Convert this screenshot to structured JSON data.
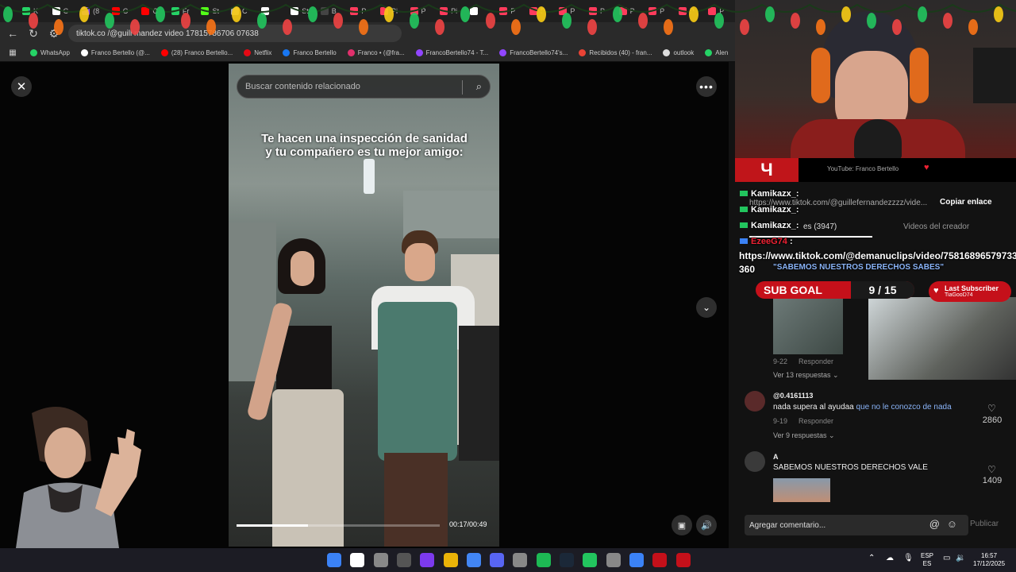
{
  "browser": {
    "url": "tiktok.com/@guillefernandezzzz/video/7581781578670607638",
    "url_display": "tiktok.co    /@guill    mandez     video    17815786706 07638",
    "tabs": [
      {
        "label": "K",
        "color": "#25d366"
      },
      {
        "label": "C",
        "color": "#ffffff"
      },
      {
        "label": "(8",
        "color": "#9146ff"
      },
      {
        "label": "C",
        "color": "#ff0000"
      },
      {
        "label": "C",
        "color": "#ff0000"
      },
      {
        "label": "Fr",
        "color": "#25d366"
      },
      {
        "label": "St",
        "color": "#53fc18"
      },
      {
        "label": "C",
        "color": "#aaaaaa"
      },
      {
        "label": "",
        "color": "#ffffff"
      },
      {
        "label": "St",
        "color": "#ffffff"
      },
      {
        "label": "B",
        "color": "#444444"
      },
      {
        "label": "P",
        "color": "#ff3b5c"
      },
      {
        "label": "Pi",
        "color": "#ff3b5c"
      },
      {
        "label": "P",
        "color": "#ff3b5c"
      },
      {
        "label": "Pi",
        "color": "#ff3b5c"
      },
      {
        "label": "",
        "color": "#ffffff"
      },
      {
        "label": "P",
        "color": "#ff3b5c"
      },
      {
        "label": "P",
        "color": "#ff3b5c"
      },
      {
        "label": "P",
        "color": "#ff3b5c"
      },
      {
        "label": "P",
        "color": "#ff3b5c"
      },
      {
        "label": "P",
        "color": "#ff3b5c"
      },
      {
        "label": "P",
        "color": "#ff3b5c"
      },
      {
        "label": "P",
        "color": "#ff3b5c"
      },
      {
        "label": "P",
        "color": "#ff3b5c"
      }
    ],
    "bookmarks": [
      {
        "label": "WhatsApp",
        "color": "#25d366"
      },
      {
        "label": "Franco Bertello (@...",
        "color": "#ffffff"
      },
      {
        "label": "(28) Franco Bertello...",
        "color": "#ff0000"
      },
      {
        "label": "Netflix",
        "color": "#e50914"
      },
      {
        "label": "Franco Bertello",
        "color": "#1877f2"
      },
      {
        "label": "Franco • (@fra...",
        "color": "#e1306c"
      },
      {
        "label": "FrancoBertello74 - T...",
        "color": "#9146ff"
      },
      {
        "label": "FrancoBertello74's...",
        "color": "#9146ff"
      },
      {
        "label": "Recibidos (40) - fran...",
        "color": "#ea4335"
      },
      {
        "label": "outlook",
        "color": "#dddddd"
      },
      {
        "label": "Alen",
        "color": "#25d366"
      }
    ]
  },
  "video": {
    "search_placeholder": "Buscar contenido relacionado",
    "caption_line1": "Te hacen una inspección de sanidad",
    "caption_line2": "y tu compañero es tu mejor amigo:",
    "timecode": "00:17/00:49",
    "progress": 0.35
  },
  "panel": {
    "link_url": "https://www.tiktok.com/@guillefernandezzzz/vide...",
    "copy_link": "Copiar enlace",
    "tab_comments": "Comentarios (3947)",
    "tab_comments_visible": "es (3947)",
    "tab_creator": "Videos del creador",
    "comments": [
      {
        "meta": "9-22",
        "reply": "Responder",
        "replies": "Ver 13 respuestas"
      },
      {
        "user": "@0.4161113",
        "text_plain": "nada supera al ayudaa ",
        "text_link": "que no le conozco de nada",
        "meta": "9-19",
        "reply": "Responder",
        "likes": "2860",
        "replies": "Ver 9 respuestas"
      },
      {
        "user": "A",
        "text_plain": "SABEMOS NUESTROS DERECHOS VALE",
        "likes": "1409"
      }
    ],
    "add_comment_placeholder": "Agregar comentario...",
    "publish": "Publicar"
  },
  "stream": {
    "yt_text": "YouTube: Franco Bertello",
    "chat": [
      {
        "user": "Kamikazx_:",
        "text": ""
      },
      {
        "user": "Kamikazx_:",
        "text": ""
      },
      {
        "user": "Kamikazx_:",
        "text": ""
      },
      {
        "user": "EzeeG74",
        "text": ":"
      },
      {
        "user": "",
        "text": "https://www.tiktok.com/@demanuclips/video/7581689657973378"
      },
      {
        "user": "",
        "text": "360"
      },
      {
        "user": "",
        "text": "\"SABEMOS NUESTROS DERECHOS SABES\""
      }
    ],
    "sub_goal_label": "SUB GOAL",
    "sub_goal_count": "9 / 15",
    "last_sub_title": "Last Subscriber",
    "last_sub_name": "TiaGooD74"
  },
  "taskbar": {
    "lang_top": "ESP",
    "lang_bottom": "ES",
    "time": "16:57",
    "date": "17/12/2025"
  },
  "colors": {
    "accent_red": "#c5101a",
    "panel_bg": "#121212",
    "link_blue": "#8ab4f8"
  }
}
